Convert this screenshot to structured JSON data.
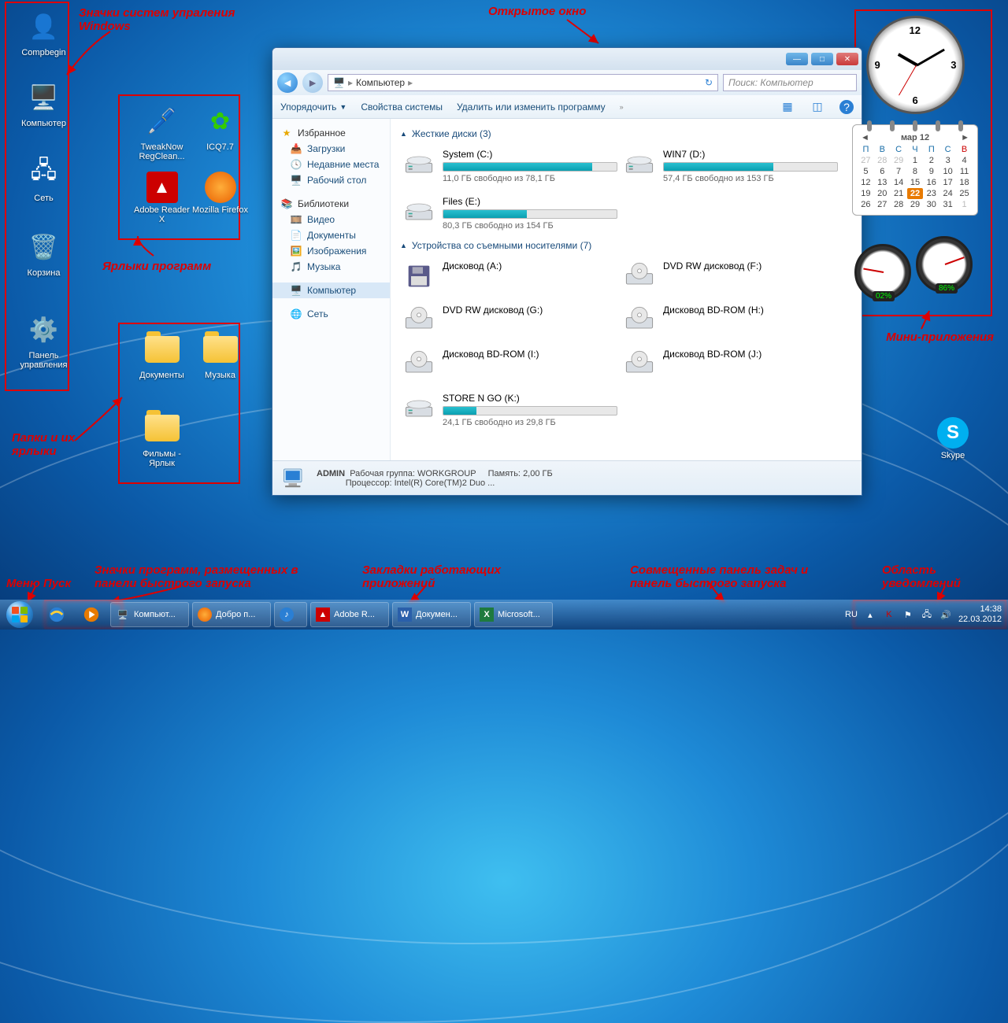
{
  "annotations": {
    "sys_icons": "Значки систем упраления Windows",
    "shortcuts": "Ярлыки программ",
    "folders": "Папки и их ярлыки",
    "open_window": "Открытое окно",
    "gadgets": "Мини-приложения",
    "start_menu": "Меню Пуск",
    "quick_launch": "Значки программ, размещенных в панели быстрого запуска",
    "running_apps": "Закладки работающих приложений",
    "taskbar_combined": "Совмещенные панель задач и панель быстрого запуска",
    "notif_area": "Область уведомлений"
  },
  "desktop": {
    "sys": [
      {
        "label": "Compbegin"
      },
      {
        "label": "Компьютер"
      },
      {
        "label": "Сеть"
      },
      {
        "label": "Корзина"
      },
      {
        "label": "Панель управления"
      }
    ],
    "shortcuts": [
      {
        "label": "TweakNow RegClean..."
      },
      {
        "label": "ICQ7.7"
      },
      {
        "label": "Adobe Reader X"
      },
      {
        "label": "Mozilla Firefox"
      }
    ],
    "folders": [
      {
        "label": "Документы"
      },
      {
        "label": "Музыка"
      },
      {
        "label": "Фильмы - Ярлык"
      }
    ],
    "skype": "Skype"
  },
  "explorer": {
    "breadcrumb": "Компьютер",
    "search_ph": "Поиск: Компьютер",
    "toolbar": {
      "organize": "Упорядочить",
      "props": "Свойства системы",
      "uninstall": "Удалить или изменить программу"
    },
    "side": {
      "fav": "Избранное",
      "fav_items": [
        "Загрузки",
        "Недавние места",
        "Рабочий стол"
      ],
      "lib": "Библиотеки",
      "lib_items": [
        "Видео",
        "Документы",
        "Изображения",
        "Музыка"
      ],
      "computer": "Компьютер",
      "network": "Сеть"
    },
    "sections": {
      "drives_hdr": "Жесткие диски (3)",
      "removable_hdr": "Устройства со съемными носителями (7)"
    },
    "drives": [
      {
        "name": "System (C:)",
        "fill": 86,
        "text": "11,0 ГБ свободно из 78,1 ГБ"
      },
      {
        "name": "WIN7 (D:)",
        "fill": 63,
        "text": "57,4 ГБ свободно из 153 ГБ"
      },
      {
        "name": "Files (E:)",
        "fill": 48,
        "text": "80,3 ГБ свободно из 154 ГБ"
      }
    ],
    "removable": [
      {
        "name": "Дисковод (A:)"
      },
      {
        "name": "DVD RW дисковод (F:)"
      },
      {
        "name": "DVD RW дисковод (G:)"
      },
      {
        "name": "Дисковод BD-ROM (H:)"
      },
      {
        "name": "Дисковод BD-ROM (I:)"
      },
      {
        "name": "Дисковод BD-ROM (J:)"
      }
    ],
    "removable_drive": {
      "name": "STORE N GO (K:)",
      "fill": 19,
      "text": "24,1 ГБ свободно из 29,8 ГБ"
    },
    "status": {
      "user": "ADMIN",
      "wg_lbl": "Рабочая группа:",
      "wg": "WORKGROUP",
      "mem_lbl": "Память:",
      "mem": "2,00 ГБ",
      "cpu_lbl": "Процессор:",
      "cpu": "Intel(R) Core(TM)2 Duo ..."
    }
  },
  "gadgets": {
    "cal_month": "мар 12",
    "cal_dow": [
      "П",
      "В",
      "С",
      "Ч",
      "П",
      "С",
      "В"
    ],
    "cal_grid": [
      [
        "27",
        "28",
        "29",
        "1",
        "2",
        "3",
        "4"
      ],
      [
        "5",
        "6",
        "7",
        "8",
        "9",
        "10",
        "11"
      ],
      [
        "12",
        "13",
        "14",
        "15",
        "16",
        "17",
        "18"
      ],
      [
        "19",
        "20",
        "21",
        "22",
        "23",
        "24",
        "25"
      ],
      [
        "26",
        "27",
        "28",
        "29",
        "30",
        "31",
        "1"
      ]
    ],
    "cal_today": "22",
    "meter1": "02%",
    "meter2": "86%"
  },
  "taskbar": {
    "tasks": [
      "Компьют...",
      "Добро п...",
      "",
      "Adobe R...",
      "Докумен...",
      "Microsoft..."
    ],
    "lang": "RU",
    "time": "14:38",
    "date": "22.03.2012"
  }
}
